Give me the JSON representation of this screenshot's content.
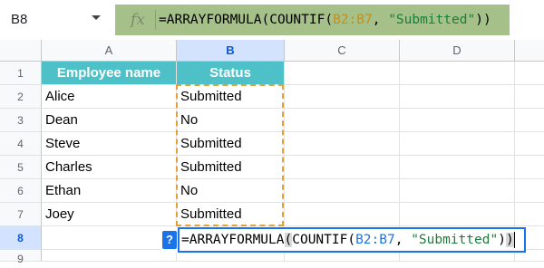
{
  "name_box": {
    "value": "B8"
  },
  "formula_bar": {
    "fx": "fx",
    "prefix": "=ARRAYFORMULA(COUNTIF(",
    "range": "B2:B7",
    "mid": ", ",
    "criterion": "\"Submitted\"",
    "suffix": "))"
  },
  "columns": [
    "A",
    "B",
    "C",
    "D"
  ],
  "rows": [
    "1",
    "2",
    "3",
    "4",
    "5",
    "6",
    "7",
    "8",
    "9"
  ],
  "table": {
    "headers": {
      "a": "Employee name",
      "b": "Status"
    },
    "data": [
      {
        "name": "Alice",
        "status": "Submitted"
      },
      {
        "name": "Dean",
        "status": "No"
      },
      {
        "name": "Steve",
        "status": "Submitted"
      },
      {
        "name": "Charles",
        "status": "Submitted"
      },
      {
        "name": "Ethan",
        "status": "No"
      },
      {
        "name": "Joey",
        "status": "Submitted"
      }
    ]
  },
  "editor": {
    "help": "?",
    "prefix": "=ARRAYFORMULA",
    "open_paren": "(",
    "fn": "COUNTIF(",
    "range": "B2:B7",
    "mid": ", ",
    "criterion": "\"Submitted\"",
    "inner_close": ")",
    "outer_close": ")"
  },
  "colors": {
    "header_fill": "#4ec1c8",
    "formula_bar_fill": "#a6c08a",
    "range_highlight": "#e0a03a",
    "selection_blue": "#1a73e8"
  }
}
